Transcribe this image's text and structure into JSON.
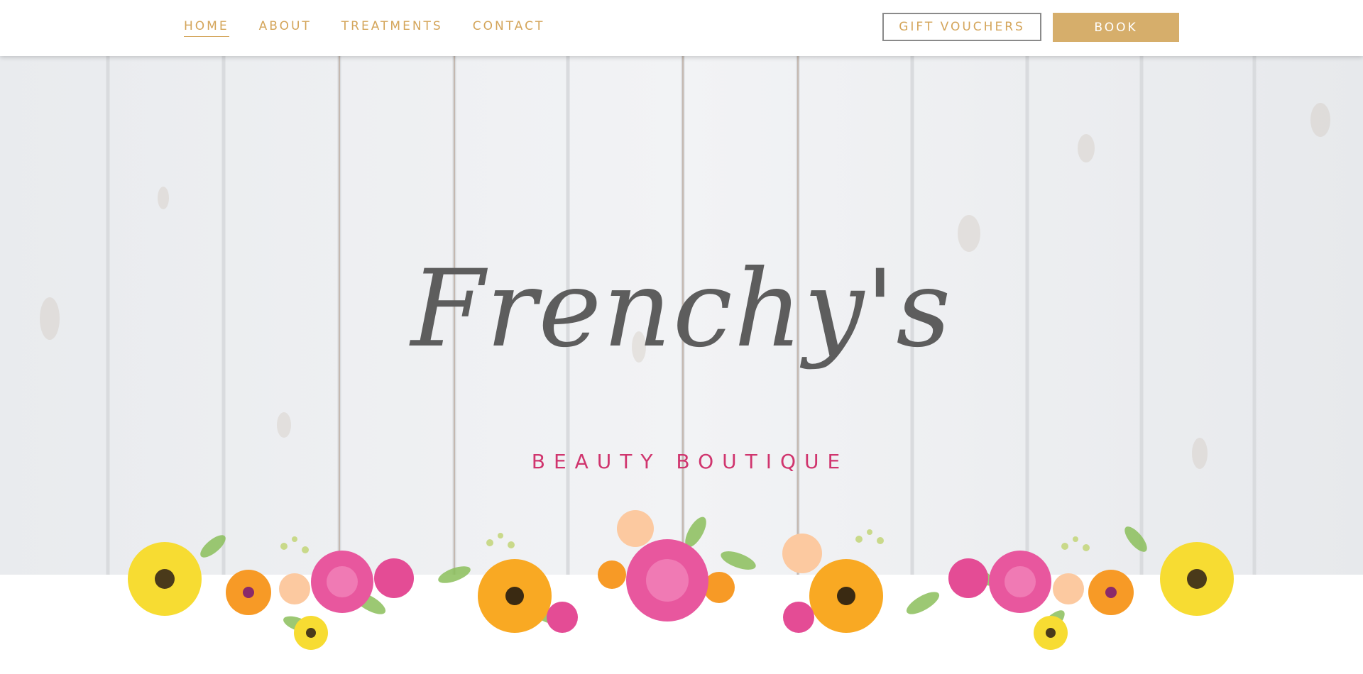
{
  "nav": {
    "items": [
      {
        "label": "HOME",
        "active": true
      },
      {
        "label": "ABOUT",
        "active": false
      },
      {
        "label": "TREATMENTS",
        "active": false
      },
      {
        "label": "CONTACT",
        "active": false
      }
    ]
  },
  "actions": {
    "gift_label": "GIFT VOUCHERS",
    "book_label": "BOOK"
  },
  "hero": {
    "logo_script": "Frenchy's",
    "logo_subtitle": "BEAUTY BOUTIQUE"
  },
  "colors": {
    "gold": "#d4a55a",
    "book_bg": "#d6ae6b",
    "script": "#5d5d5d",
    "subtitle": "#d0356e"
  }
}
